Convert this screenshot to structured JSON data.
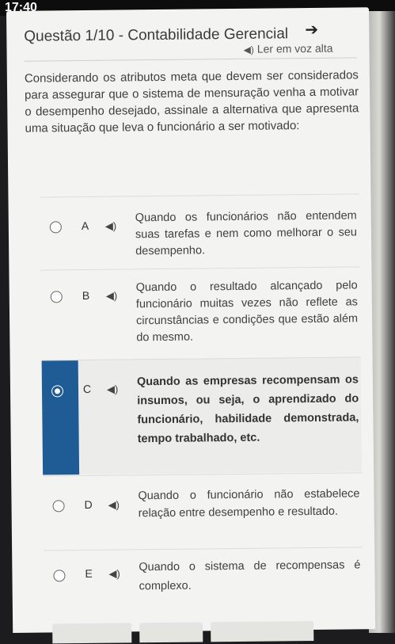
{
  "status": {
    "time": "17:40"
  },
  "header": {
    "title": "Questão 1/10 - Contabilidade Gerencial",
    "audio_link": "Ler em voz alta"
  },
  "question": {
    "text": "Considerando os atributos meta que devem ser considerados para assegurar que o sistema de mensuração venha a motivar o desempenho desejado, assinale a alternativa que apresenta uma situação que leva o funcionário a ser motivado:"
  },
  "options": [
    {
      "letter": "A",
      "text": "Quando os funcionários não entendem suas tarefas e nem como melhorar o seu desempenho.",
      "selected": false
    },
    {
      "letter": "B",
      "text": "Quando o resultado alcançado pelo funcionário muitas vezes não reflete as circunstâncias e condições que estão além do mesmo.",
      "selected": false
    },
    {
      "letter": "C",
      "text": "Quando as empresas recompensam os insumos, ou seja, o aprendizado do funcionário, habilidade demonstrada, tempo trabalhado, etc.",
      "selected": true
    },
    {
      "letter": "D",
      "text": "Quando o funcionário não estabelece relação entre desempenho e resultado.",
      "selected": false
    },
    {
      "letter": "E",
      "text": "Quando o sistema de recompensas é complexo.",
      "selected": false
    }
  ],
  "colors": {
    "selected_accent": "#1f5c96",
    "page_bg": "#f3f3f1",
    "text": "#404040"
  }
}
